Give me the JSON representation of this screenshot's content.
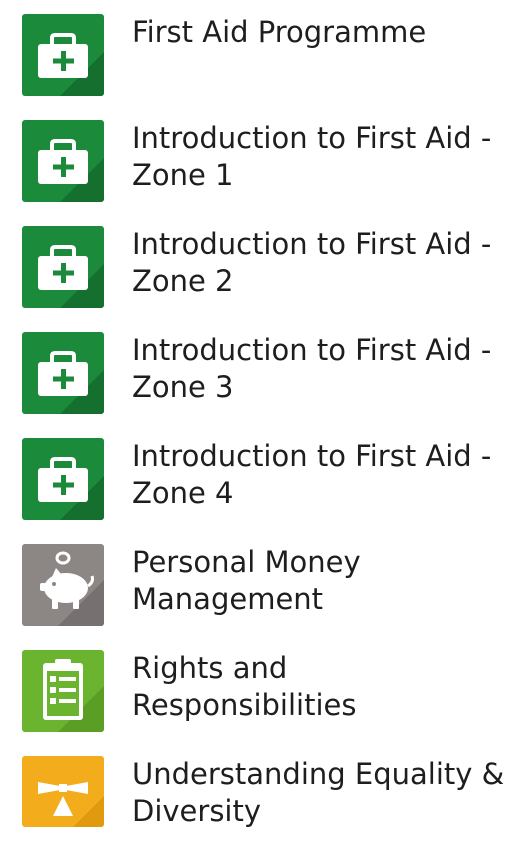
{
  "courses": [
    {
      "title": "First Aid Programme",
      "icon": "first-aid-kit-icon",
      "color": "#1b8a3a"
    },
    {
      "title": "Introduction to First Aid - Zone 1",
      "icon": "first-aid-kit-icon",
      "color": "#1b8a3a"
    },
    {
      "title": "Introduction to First Aid - Zone 2",
      "icon": "first-aid-kit-icon",
      "color": "#1b8a3a"
    },
    {
      "title": "Introduction to First Aid - Zone 3",
      "icon": "first-aid-kit-icon",
      "color": "#1b8a3a"
    },
    {
      "title": "Introduction to First Aid - Zone 4",
      "icon": "first-aid-kit-icon",
      "color": "#1b8a3a"
    },
    {
      "title": "Personal Money Management",
      "icon": "piggy-bank-icon",
      "color": "#8c8684"
    },
    {
      "title": "Rights and Responsibilities",
      "icon": "checklist-clipboard-icon",
      "color": "#6ab42f"
    },
    {
      "title": "Understanding Equality & Diversity",
      "icon": "balance-scale-icon",
      "color": "#f2ac1c"
    }
  ]
}
